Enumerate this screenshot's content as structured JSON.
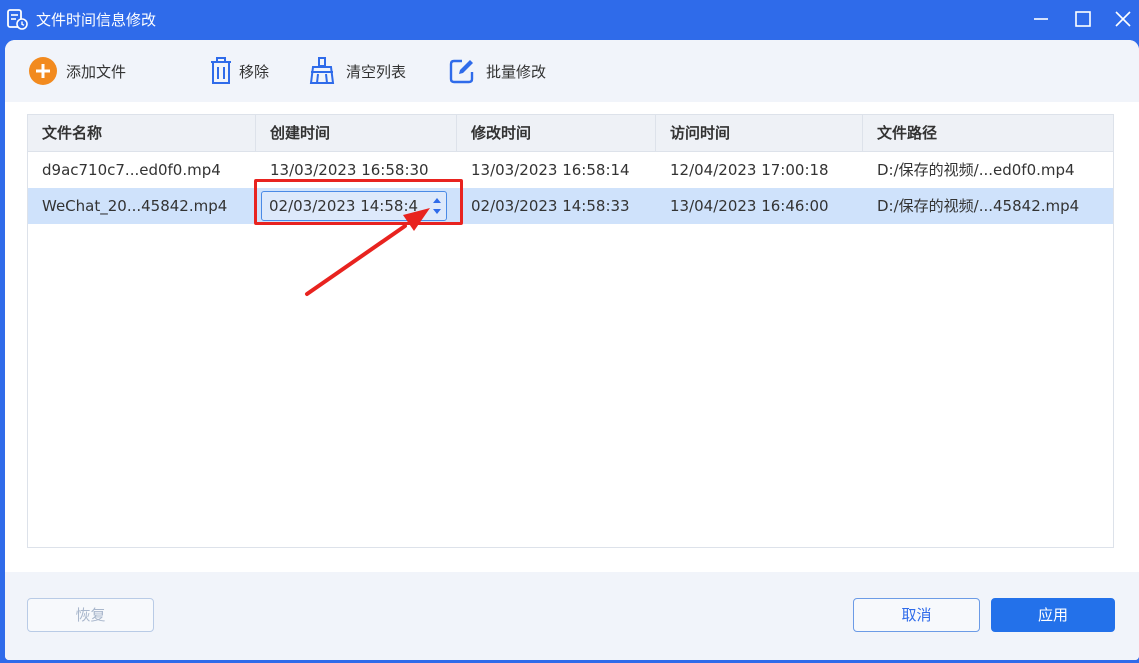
{
  "window": {
    "title": "文件时间信息修改"
  },
  "toolbar": {
    "add_label": "添加文件",
    "remove_label": "移除",
    "clear_label": "清空列表",
    "batch_label": "批量修改"
  },
  "table": {
    "columns": [
      "文件名称",
      "创建时间",
      "修改时间",
      "访问时间",
      "文件路径"
    ],
    "rows": [
      {
        "name": "d9ac710c7...ed0f0.mp4",
        "created": "13/03/2023 16:58:30",
        "modified": "13/03/2023 16:58:14",
        "accessed": "12/04/2023 17:00:18",
        "path": "D:/保存的视频/...ed0f0.mp4"
      },
      {
        "name": "WeChat_20...45842.mp4",
        "created": "02/03/2023 14:58:4",
        "modified": "02/03/2023 14:58:33",
        "accessed": "13/04/2023 16:46:00",
        "path": "D:/保存的视频/...45842.mp4",
        "selected": true
      }
    ]
  },
  "footer": {
    "restore_label": "恢复",
    "cancel_label": "取消",
    "apply_label": "应用"
  },
  "colors": {
    "accent": "#2f6bea",
    "apply_button": "#2371ea",
    "selected_row": "#cfe2fb",
    "annotation": "#e8231f",
    "add_icon": "#f28a1e"
  },
  "icons": {
    "app": "document-clock-icon",
    "add": "plus-circle-icon",
    "remove": "trash-icon",
    "clear": "broom-icon",
    "batch": "edit-square-icon"
  }
}
